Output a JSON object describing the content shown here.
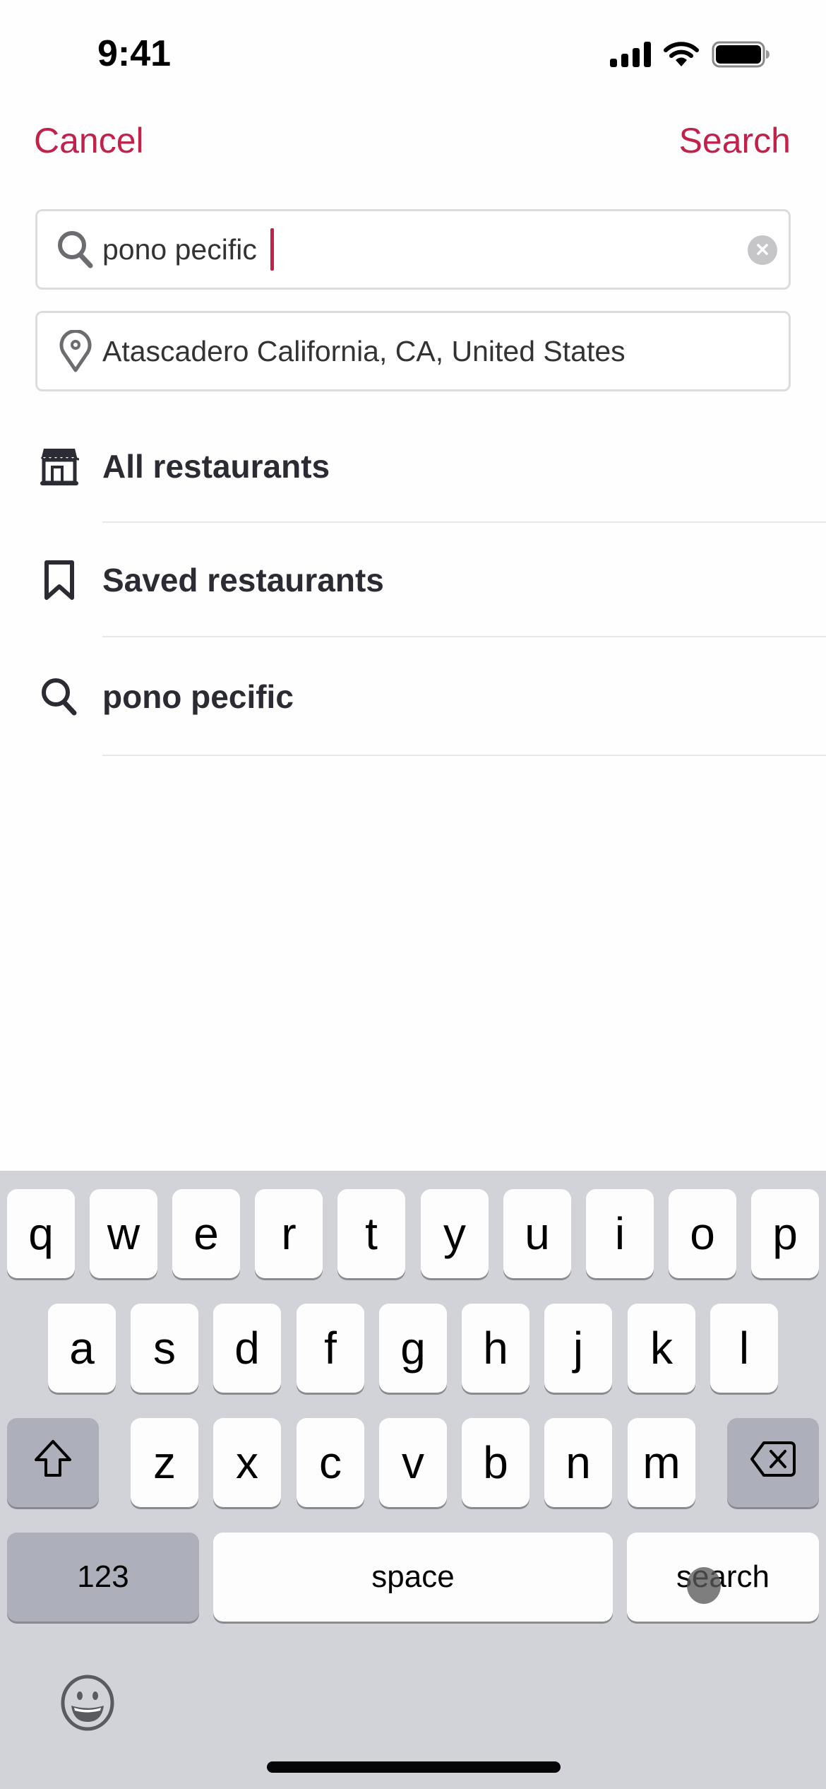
{
  "status_bar": {
    "time": "9:41",
    "icons": [
      "cellular-signal-icon",
      "wifi-icon",
      "battery-icon"
    ]
  },
  "nav": {
    "cancel_label": "Cancel",
    "search_label": "Search",
    "accent_color": "#c0224b"
  },
  "search_field": {
    "value": "pono pecific",
    "icon": "search-icon",
    "clear_icon": "clear-icon"
  },
  "location_field": {
    "value": "Atascadero California, CA, United States",
    "icon": "location-pin-icon"
  },
  "suggestions": [
    {
      "label": "All restaurants",
      "icon": "storefront-icon"
    },
    {
      "label": "Saved restaurants",
      "icon": "bookmark-icon"
    },
    {
      "label": "pono pecific",
      "icon": "search-icon"
    }
  ],
  "keyboard": {
    "row1": [
      "q",
      "w",
      "e",
      "r",
      "t",
      "y",
      "u",
      "i",
      "o",
      "p"
    ],
    "row2": [
      "a",
      "s",
      "d",
      "f",
      "g",
      "h",
      "j",
      "k",
      "l"
    ],
    "row3": [
      "z",
      "x",
      "c",
      "v",
      "b",
      "n",
      "m"
    ],
    "shift_icon": "shift-icon",
    "delete_icon": "backspace-icon",
    "numbers_label": "123",
    "space_label": "space",
    "return_label": "search",
    "emoji_icon": "emoji-icon"
  }
}
